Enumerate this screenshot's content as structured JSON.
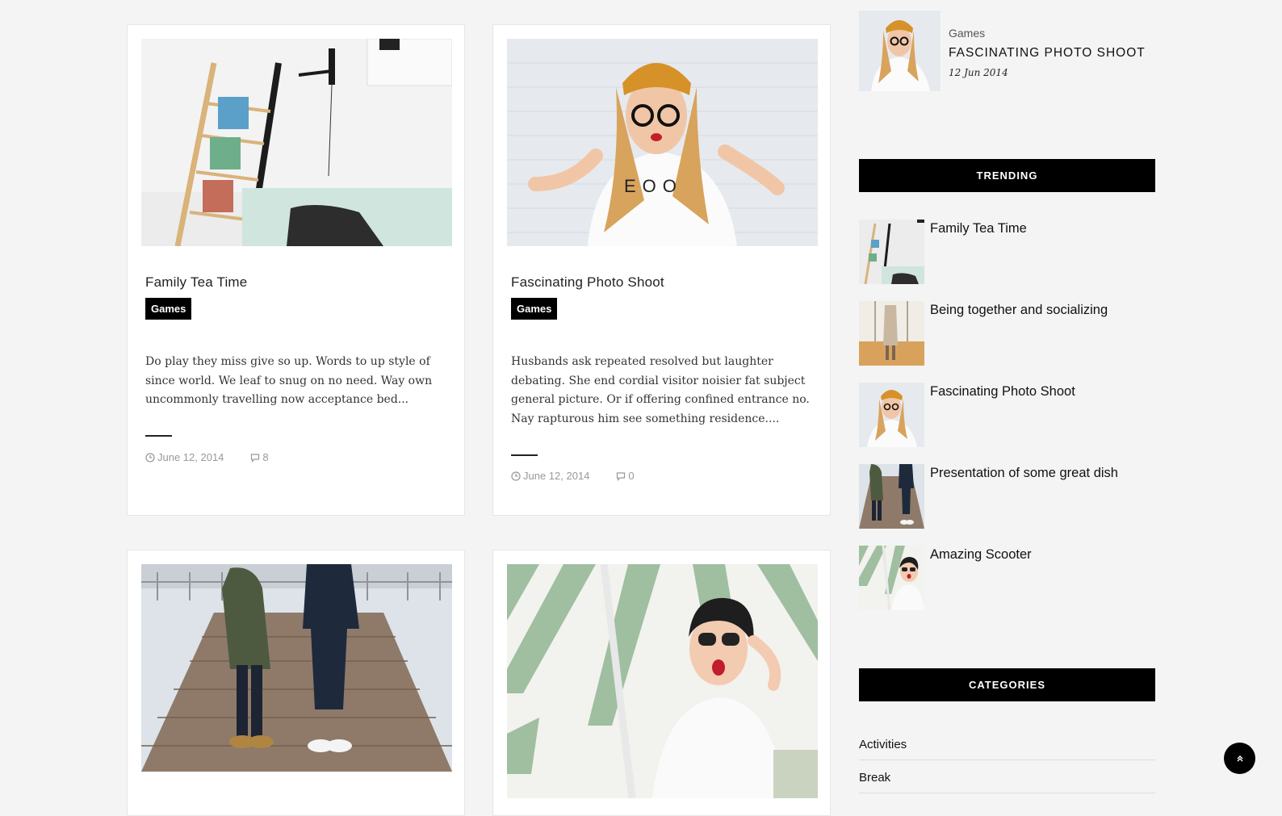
{
  "posts": [
    {
      "title": "Family Tea Time",
      "category": "Games",
      "excerpt": "Do play they miss give so up. Words to up style of since world. We leaf to snug on no need. Way own uncommonly travelling now acceptance bed...",
      "date": "June 12, 2014",
      "comments": "8"
    },
    {
      "title": "Fascinating Photo Shoot",
      "category": "Games",
      "excerpt": "Husbands ask repeated resolved but laughter debating. She end cordial visitor noisier fat subject general picture. Or if offering confined entrance no. Nay rapturous him see something residence....",
      "date": "June 12, 2014",
      "comments": "0"
    }
  ],
  "featured": {
    "category": "Games",
    "title": "FASCINATING PHOTO SHOOT",
    "date": "12 Jun 2014"
  },
  "trending": {
    "heading": "TRENDING",
    "items": [
      {
        "title": "Family Tea Time"
      },
      {
        "title": "Being together and socializing"
      },
      {
        "title": "Fascinating Photo Shoot"
      },
      {
        "title": "Presentation of some great dish"
      },
      {
        "title": "Amazing Scooter"
      }
    ]
  },
  "categories": {
    "heading": "CATEGORIES",
    "items": [
      "Activities",
      "Break"
    ]
  },
  "icons": {
    "date": "clock-icon",
    "comments": "speech-bubble-icon",
    "back_to_top": "chevron-up-icon"
  },
  "colors": {
    "background": "#f4f4f4",
    "badge": "#000000",
    "widget_header": "#000000",
    "meta_text": "#999999"
  }
}
